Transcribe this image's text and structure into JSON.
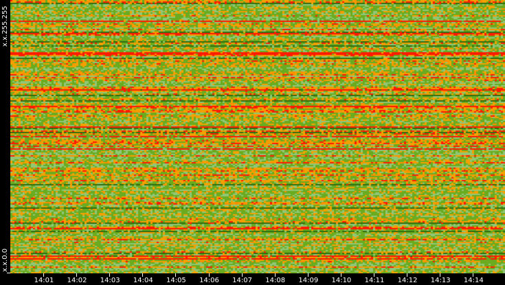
{
  "chart_data": {
    "type": "heatmap",
    "title": "",
    "xlabel": "",
    "ylabel": "",
    "x_ticks": [
      "14:01",
      "14:02",
      "14:03",
      "14:04",
      "14:05",
      "14:06",
      "14:07",
      "14:08",
      "14:09",
      "14:10",
      "14:11",
      "14:12",
      "14:13",
      "14:14"
    ],
    "y_labels": {
      "top": "x.x.255.255",
      "bottom": "x.x.0.0"
    },
    "color_scale": [
      "#2f6e10",
      "#6aab1f",
      "#8fc777",
      "#f2a100",
      "#ff8c00",
      "#ff1a00"
    ],
    "grid": false,
    "legend": "none"
  }
}
